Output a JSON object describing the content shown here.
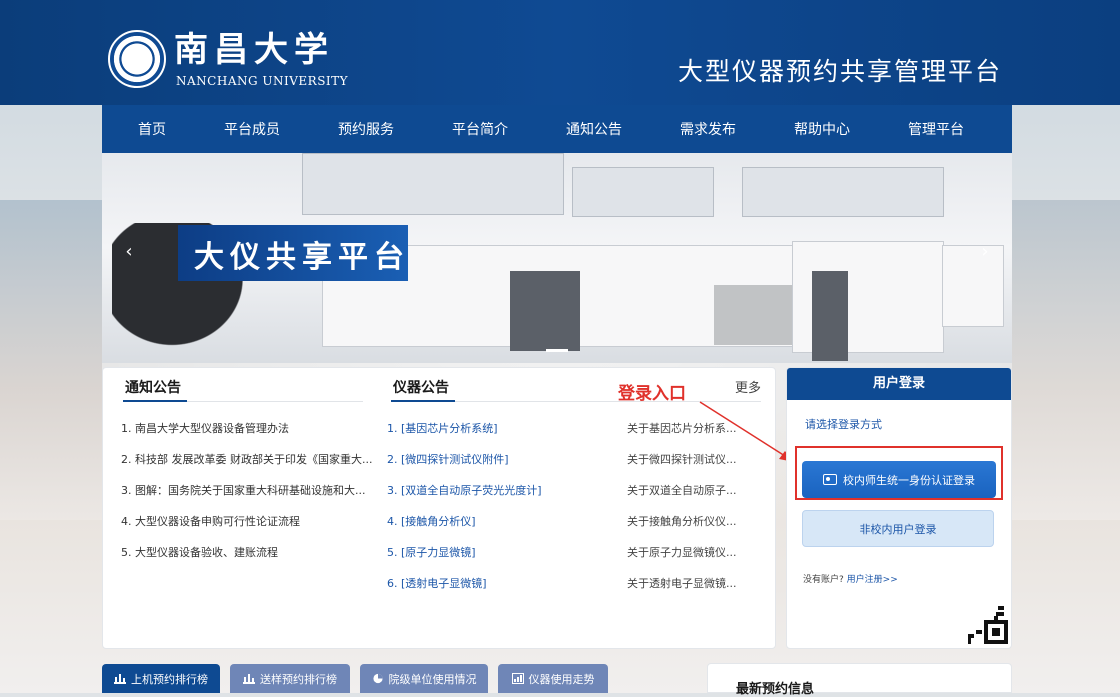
{
  "header": {
    "logo_cn": "南昌大学",
    "logo_en": "NANCHANG UNIVERSITY",
    "platform_title": "大型仪器预约共享管理平台"
  },
  "nav": {
    "items": [
      "首页",
      "平台成员",
      "预约服务",
      "平台简介",
      "通知公告",
      "需求发布",
      "帮助中心",
      "管理平台"
    ]
  },
  "banner": {
    "title": "大仪共享平台",
    "prev": "‹",
    "next": "›"
  },
  "notices": {
    "title": "通知公告",
    "items": [
      "1. 南昌大学大型仪器设备管理办法",
      "2. 科技部 发展改革委 财政部关于印发《国家重大...",
      "3. 图解：国务院关于国家重大科研基础设施和大...",
      "4. 大型仪器设备申购可行性论证流程",
      "5. 大型仪器设备验收、建账流程"
    ]
  },
  "instruments": {
    "title": "仪器公告",
    "more": "更多",
    "items": [
      {
        "name": "1. [基因芯片分析系统]",
        "desc": "关于基因芯片分析系..."
      },
      {
        "name": "2. [微四探针测试仪附件]",
        "desc": "关于微四探针测试仪..."
      },
      {
        "name": "3. [双道全自动原子荧光光度计]",
        "desc": "关于双道全自动原子..."
      },
      {
        "name": "4. [接触角分析仪]",
        "desc": "关于接触角分析仪仪..."
      },
      {
        "name": "5. [原子力显微镜]",
        "desc": "关于原子力显微镜仪..."
      },
      {
        "name": "6. [透射电子显微镜]",
        "desc": "关于透射电子显微镜..."
      }
    ]
  },
  "annotation": "登录入口",
  "login": {
    "title": "用户登录",
    "prompt": "请选择登录方式",
    "sso_button": "校内师生统一身份认证登录",
    "external_button": "非校内用户登录",
    "no_account": "没有账户?",
    "register_link": "用户注册>>"
  },
  "bottom_tabs": [
    {
      "label": "上机预约排行榜",
      "icon": "bar-chart-icon",
      "active": true
    },
    {
      "label": "送样预约排行榜",
      "icon": "bar-chart-icon",
      "active": false
    },
    {
      "label": "院级单位使用情况",
      "icon": "pie-chart-icon",
      "active": false
    },
    {
      "label": "仪器使用走势",
      "icon": "trend-chart-icon",
      "active": false
    }
  ],
  "latest": {
    "title": "最新预约信息"
  },
  "colors": {
    "brand": "#0e4a92",
    "accent_blue": "#1c56a8",
    "annotation_red": "#e0312b"
  }
}
